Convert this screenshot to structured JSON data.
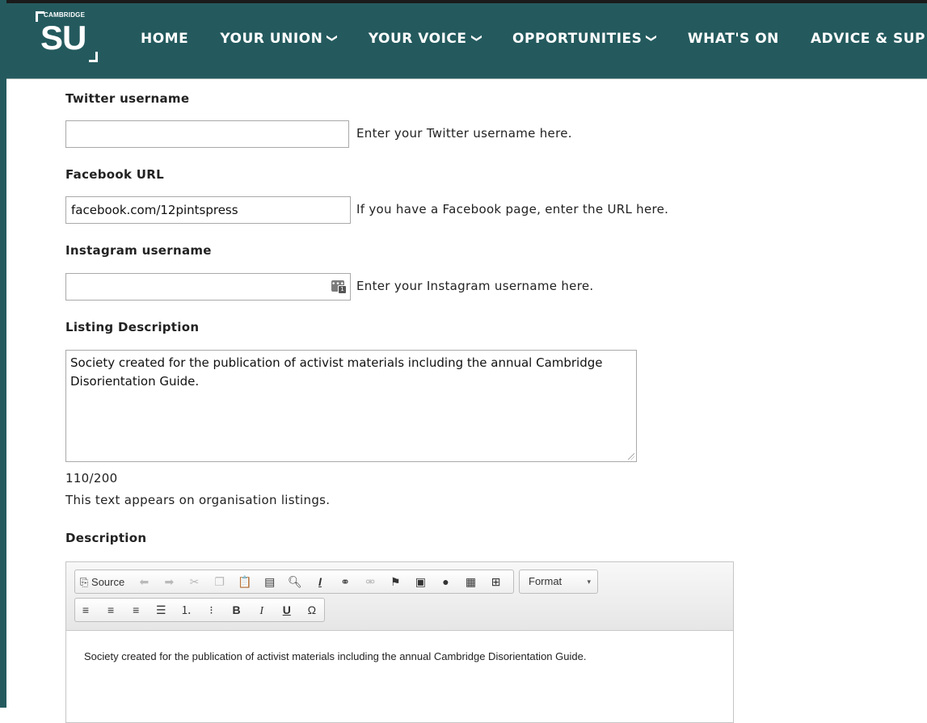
{
  "logo": {
    "small_text": "CAMBRIDGE",
    "big_text": "SU"
  },
  "nav": [
    {
      "label": "HOME",
      "dropdown": false
    },
    {
      "label": "YOUR UNION",
      "dropdown": true
    },
    {
      "label": "YOUR VOICE",
      "dropdown": true
    },
    {
      "label": "OPPORTUNITIES",
      "dropdown": true
    },
    {
      "label": "WHAT'S ON",
      "dropdown": false
    },
    {
      "label": "ADVICE & SUP",
      "dropdown": false
    }
  ],
  "form": {
    "twitter": {
      "label": "Twitter username",
      "value": "",
      "help": "Enter your Twitter username here."
    },
    "facebook": {
      "label": "Facebook URL",
      "value": "facebook.com/12pintspress",
      "help": "If you have a Facebook page, enter the URL here."
    },
    "instagram": {
      "label": "Instagram username",
      "value": "",
      "help": "Enter your Instagram username here."
    },
    "listing": {
      "label": "Listing Description",
      "value": "Society created for the publication of activist materials including the annual Cambridge Disorientation Guide.",
      "counter": "110/200",
      "help": "This text appears on organisation listings."
    },
    "description": {
      "label": "Description",
      "toolbar": {
        "source_label": "Source",
        "format_label": "Format",
        "row1_icons": [
          "source-icon",
          "undo-icon",
          "redo-icon",
          "cut-icon",
          "copy-icon",
          "paste-icon",
          "paste-from-word-icon",
          "find-icon",
          "remove-format-icon",
          "link-icon",
          "unlink-icon",
          "anchor-icon",
          "image-icon",
          "flash-icon",
          "youtube-icon",
          "table-icon"
        ],
        "row2_icons": [
          "align-left-icon",
          "align-center-icon",
          "align-right-icon",
          "justify-icon",
          "numbered-list-icon",
          "bulleted-list-icon",
          "bold-icon",
          "italic-icon",
          "underline-icon",
          "special-char-icon"
        ]
      },
      "body": "Society created for the publication of activist materials including the annual Cambridge Disorientation Guide."
    }
  },
  "colors": {
    "nav_bg": "#245a5e",
    "nav_text": "#ffffff"
  }
}
